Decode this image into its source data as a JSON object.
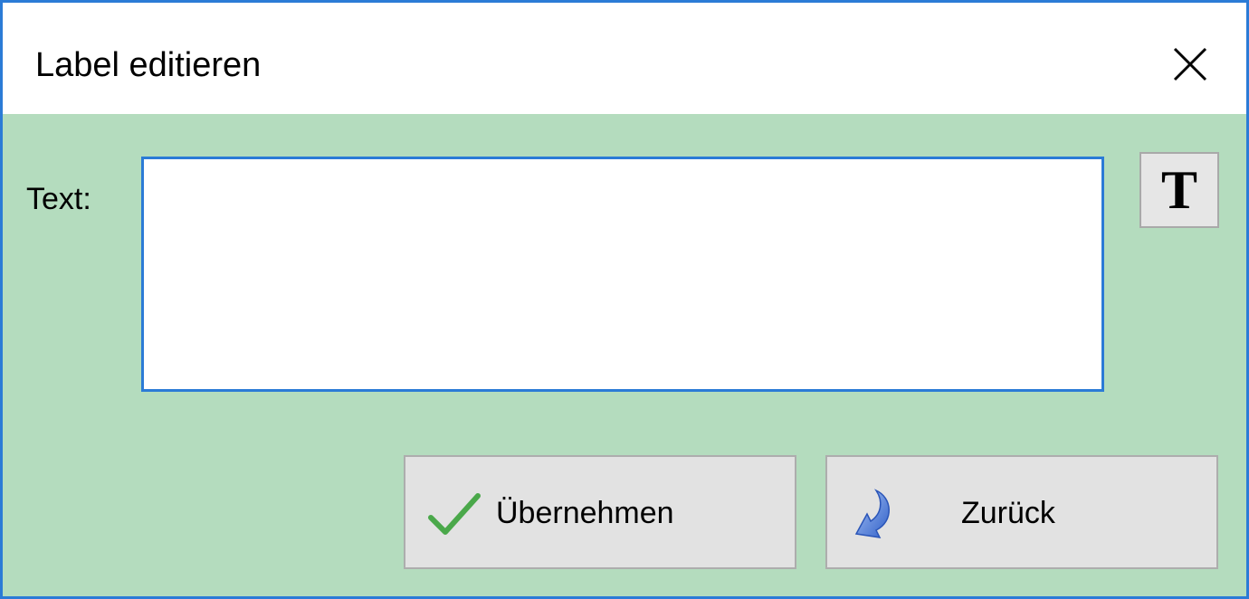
{
  "window": {
    "title": "Label editieren"
  },
  "form": {
    "text_label": "Text:",
    "text_value": "",
    "font_button_glyph": "T"
  },
  "buttons": {
    "apply_label": "Übernehmen",
    "back_label": "Zurück"
  },
  "icons": {
    "close": "close-icon",
    "font": "font-icon",
    "apply": "checkmark-icon",
    "back": "undo-arrow-icon"
  },
  "colors": {
    "window_border": "#2b7bd6",
    "client_background": "#b4dcbe",
    "button_background": "#e2e2e2",
    "checkmark": "#4aa84a",
    "undo_arrow": "#3e6fd8"
  }
}
